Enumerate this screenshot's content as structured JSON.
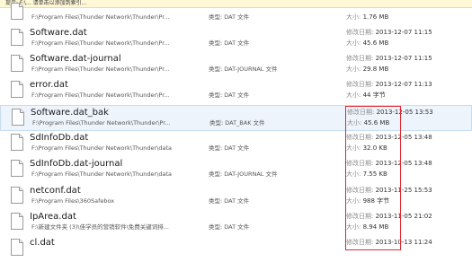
{
  "infobar": {
    "text": "提示: F:\\... 请单击以添加到索引..."
  },
  "rows": [
    {
      "name": "",
      "path": "F:\\Program Files\\Thunder Network\\Thunder\\Pr...",
      "type": "类型: DAT 文件",
      "date_label": "",
      "date": "",
      "size_label": "大小:",
      "size": "1.76 MB"
    },
    {
      "name": "Software.dat",
      "path": "F:\\Program Files\\Thunder Network\\Thunder\\Pr...",
      "type": "类型: DAT 文件",
      "date_label": "修改日期:",
      "date": "2013-12-07 11:15",
      "size_label": "大小:",
      "size": "45.6 MB"
    },
    {
      "name": "Software.dat-journal",
      "path": "F:\\Program Files\\Thunder Network\\Thunder\\Pr...",
      "type": "类型: DAT-JOURNAL 文件",
      "date_label": "修改日期:",
      "date": "2013-12-07 11:15",
      "size_label": "大小:",
      "size": "29.8 MB"
    },
    {
      "name": "error.dat",
      "path": "F:\\Program Files\\Thunder Network\\Thunder\\Pr...",
      "type": "类型: DAT 文件",
      "date_label": "修改日期:",
      "date": "2013-12-07 11:13",
      "size_label": "大小:",
      "size": "44 字节"
    },
    {
      "name": "Software.dat_bak",
      "path": "F:\\Program Files\\Thunder Network\\Thunder\\Pr...",
      "type": "类型: DAT_BAK 文件",
      "date_label": "修改日期:",
      "date": "2013-12-05 13:53",
      "size_label": "大小:",
      "size": "45.6 MB"
    },
    {
      "name": "SdInfoDb.dat",
      "path": "F:\\Program Files\\Thunder Network\\Thunder\\data",
      "type": "类型: DAT 文件",
      "date_label": "修改日期:",
      "date": "2013-12-05 13:48",
      "size_label": "大小:",
      "size": "32.0 KB"
    },
    {
      "name": "SdInfoDb.dat-journal",
      "path": "F:\\Program Files\\Thunder Network\\Thunder\\data",
      "type": "类型: DAT-JOURNAL 文件",
      "date_label": "修改日期:",
      "date": "2013-12-05 13:48",
      "size_label": "大小:",
      "size": "7.55 KB"
    },
    {
      "name": "netconf.dat",
      "path": "F:\\Program Files\\360Safebox",
      "type": "类型: DAT 文件",
      "date_label": "修改日期:",
      "date": "2013-11-25 15:53",
      "size_label": "大小:",
      "size": "988 字节"
    },
    {
      "name": "IpArea.dat",
      "path": "F:\\新建文件夹 (3)\\佳学员的营销软件\\免费关键词排...",
      "type": "类型: DAT 文件",
      "date_label": "修改日期:",
      "date": "2013-11-05 21:02",
      "size_label": "大小:",
      "size": "8.94 MB"
    },
    {
      "name": "cl.dat",
      "path": "",
      "type": "",
      "date_label": "修改日期:",
      "date": "2013-10-13 11:24",
      "size_label": "",
      "size": ""
    }
  ],
  "colors": {
    "highlight_box": "#e0262f",
    "selected_row": "#eef4fb"
  }
}
